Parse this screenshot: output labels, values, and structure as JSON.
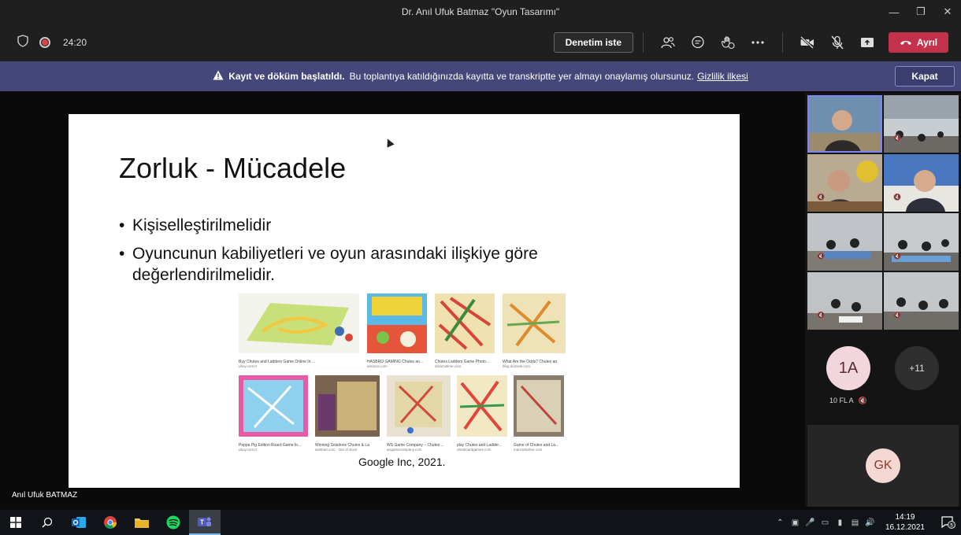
{
  "window": {
    "title": "Dr. Anıl Ufuk Batmaz \"Oyun Tasarımı\""
  },
  "toolbar": {
    "timer": "24:20",
    "control_label": "Denetim iste",
    "leave_label": "Ayrıl"
  },
  "banner": {
    "bold": "Kayıt ve döküm başlatıldı.",
    "message": "Bu toplantıya katıldığınızda kayıtta ve transkriptte yer almayı onaylamış olursunuz.",
    "link": "Gizlilik ilkesi",
    "close_label": "Kapat"
  },
  "slide": {
    "title": "Zorluk - Mücadele",
    "bullets": [
      "Kişiselleştirilmelidir",
      "Oyuncunun kabiliyetleri ve oyun arasındaki ilişkiye göre değerlendirilmelidir."
    ],
    "credit": "Google Inc, 2021.",
    "thumbs": [
      {
        "caption": "Buy Chutes and Ladders Game Online In ...",
        "source": "ubuy.com.tr"
      },
      {
        "caption": "HASBRO GAMING Chutes an...",
        "source": "amazon.com"
      },
      {
        "caption": "Chutes Ladders Game Photo...",
        "source": "dreamstime.com"
      },
      {
        "caption": "What Are the Odds? Chutes an",
        "source": "blog.dominik.com"
      },
      {
        "caption": "Peppa Pig Edition Board Game fo...",
        "source": "ubuy.com.tr"
      },
      {
        "caption": "Winning Solutions Chutes & La",
        "source": "walmart.com · Out of stock"
      },
      {
        "caption": "WS Game Company – Chutes ...",
        "source": "wsgamecompany.com"
      },
      {
        "caption": "play Chutes and Ladder...",
        "source": "ultraboardgames.com"
      },
      {
        "caption": "Game of Chutes and La...",
        "source": "mancieboline.com"
      }
    ]
  },
  "presenter": {
    "name": "Anıl Ufuk BATMAZ"
  },
  "participants": {
    "avatar_1a": "1A",
    "label_1a": "10 FL A",
    "overflow": "+11",
    "self_initials": "GK"
  },
  "taskbar": {
    "time": "14:19",
    "date": "16.12.2021",
    "notifications": "5"
  },
  "colors": {
    "accent": "#7f85f5",
    "leave": "#c4314b",
    "banner": "#45477a"
  }
}
